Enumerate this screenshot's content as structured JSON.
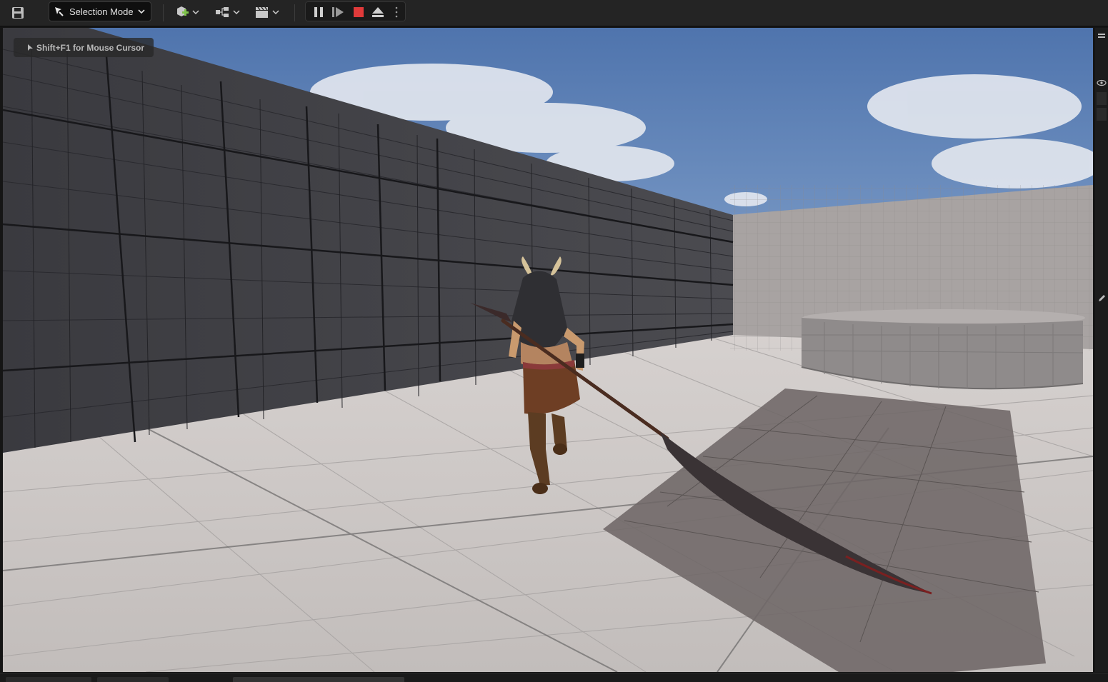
{
  "toolbar": {
    "save_icon": "save-icon",
    "selection_mode_label": "Selection Mode",
    "add_actor_icon": "add-actor-icon",
    "blueprint_icon": "blueprint-icon",
    "cinematics_icon": "clapperboard-icon",
    "pause_icon": "pause-icon",
    "frame_skip_icon": "frame-skip-icon",
    "stop_icon": "stop-icon",
    "eject_icon": "eject-icon",
    "more_icon": "more-vertical-icon",
    "stop_color": "#e03a3a",
    "add_color": "#7ec24a"
  },
  "viewport": {
    "hint_text": "Shift+F1 for Mouse Cursor",
    "sky_color": "#6d8fc0",
    "floor_color": "#c9c4c2"
  }
}
